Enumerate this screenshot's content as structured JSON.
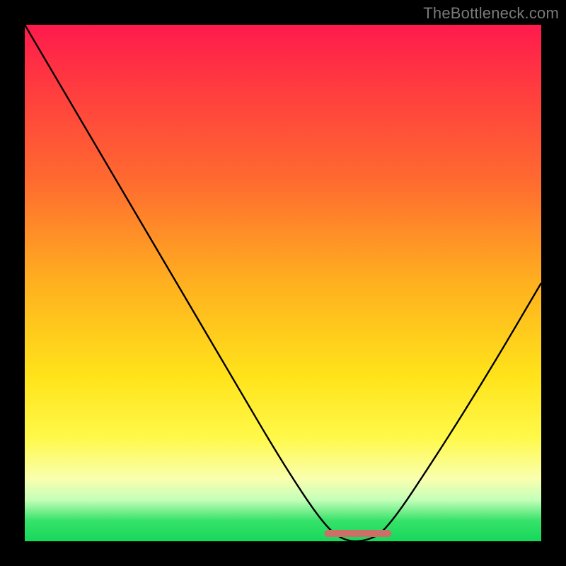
{
  "watermark": "TheBottleneck.com",
  "chart_data": {
    "type": "line",
    "title": "",
    "xlabel": "",
    "ylabel": "",
    "xlim": [
      0,
      100
    ],
    "ylim": [
      0,
      100
    ],
    "grid": false,
    "legend": false,
    "series": [
      {
        "name": "bottleneck-curve",
        "x": [
          0,
          10,
          20,
          30,
          40,
          50,
          58,
          62,
          66,
          70,
          80,
          90,
          100
        ],
        "values": [
          100,
          83,
          66,
          49,
          32,
          15,
          3,
          0,
          0,
          2,
          17,
          33,
          50
        ]
      }
    ],
    "bottom_marker": {
      "name": "optimal-range",
      "x_start": 58,
      "x_end": 71,
      "y": 1.5,
      "color": "#cc6f66"
    },
    "background_gradient": {
      "stops": [
        {
          "pos": 0,
          "color": "#ff1a4d"
        },
        {
          "pos": 12,
          "color": "#ff3b3f"
        },
        {
          "pos": 30,
          "color": "#ff6a30"
        },
        {
          "pos": 50,
          "color": "#ffb01f"
        },
        {
          "pos": 68,
          "color": "#ffe31a"
        },
        {
          "pos": 80,
          "color": "#fff94a"
        },
        {
          "pos": 88,
          "color": "#f9ffb0"
        },
        {
          "pos": 92,
          "color": "#c4ffb8"
        },
        {
          "pos": 96,
          "color": "#37e26a"
        },
        {
          "pos": 100,
          "color": "#15d85a"
        }
      ]
    }
  }
}
